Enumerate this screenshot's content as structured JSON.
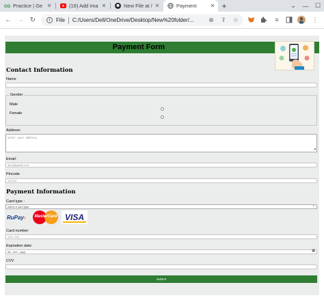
{
  "browser": {
    "tabs": [
      {
        "title": "Practice | Ge",
        "icon": "gfg-icon",
        "active": false
      },
      {
        "title": "(16) Add ima",
        "icon": "youtube-icon",
        "active": false
      },
      {
        "title": "New File at /",
        "icon": "github-icon",
        "active": false
      },
      {
        "title": "Payment",
        "icon": "globe-icon",
        "active": true
      }
    ],
    "address": {
      "scheme": "File",
      "url": "C:/Users/Dell/OneDrive/Desktop/New%20folder/..."
    }
  },
  "form": {
    "title": "Payment Form",
    "contact_heading": "Contact Information",
    "name_label": "Name",
    "gender_legend": "Gender",
    "gender_options": [
      "Male",
      "Female"
    ],
    "address_label": "Address:",
    "address_placeholder": "enter your address",
    "email_label": "Email:",
    "email_placeholder": "abcd@gmail.com",
    "pincode_label": "Pincode",
    "pincode_placeholder": "112244",
    "payment_heading": "Payment Information",
    "card_type_label": "Card type :",
    "card_type_value": "select a card type",
    "card_brands": [
      "RuPay",
      "MasterCard",
      "VISA"
    ],
    "card_number_label": "Card number:",
    "card_number_placeholder": "1111 1111",
    "expiration_label": "Expiration date:",
    "expiration_placeholder": "dd - mm - yyyy",
    "cvv_label": "CVV",
    "submit_label": "Submit"
  },
  "colors": {
    "accent": "#2e7d32",
    "form_bg": "#ebedec"
  }
}
